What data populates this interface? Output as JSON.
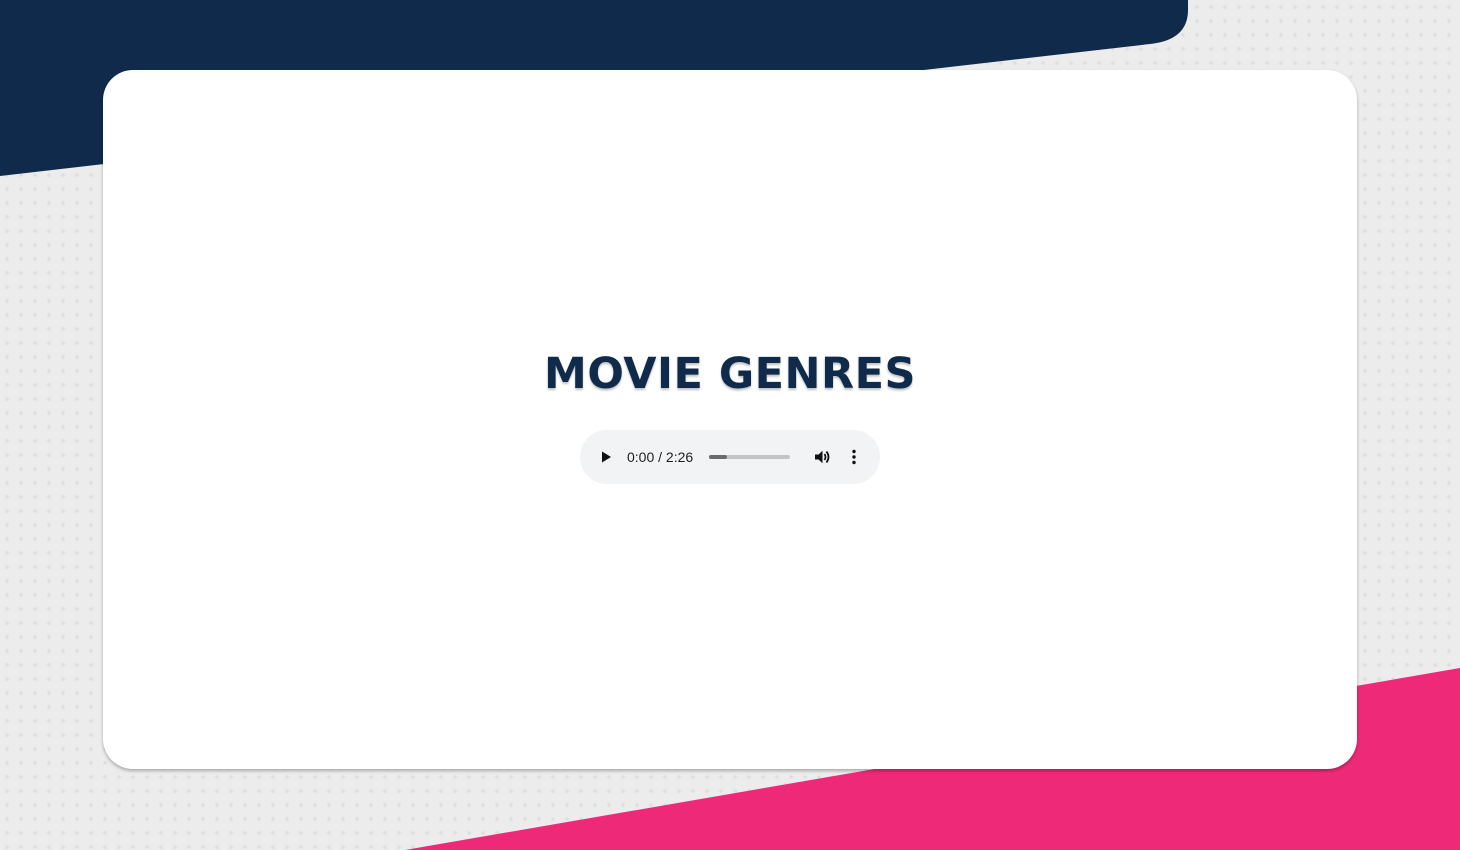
{
  "page": {
    "title": "MOVIE GENRES"
  },
  "audio_player": {
    "current_time": "0:00",
    "separator": " / ",
    "duration": "2:26",
    "time_display": "0:00 / 2:26",
    "progress_fraction": 0.22,
    "icons": {
      "play": "play-icon",
      "volume": "volume-icon",
      "more": "more-options-icon"
    }
  },
  "colors": {
    "navy": "#0f2a4a",
    "pink": "#ee2a78",
    "background": "#ececec",
    "card": "#ffffff",
    "player_bg": "#f1f3f4"
  }
}
